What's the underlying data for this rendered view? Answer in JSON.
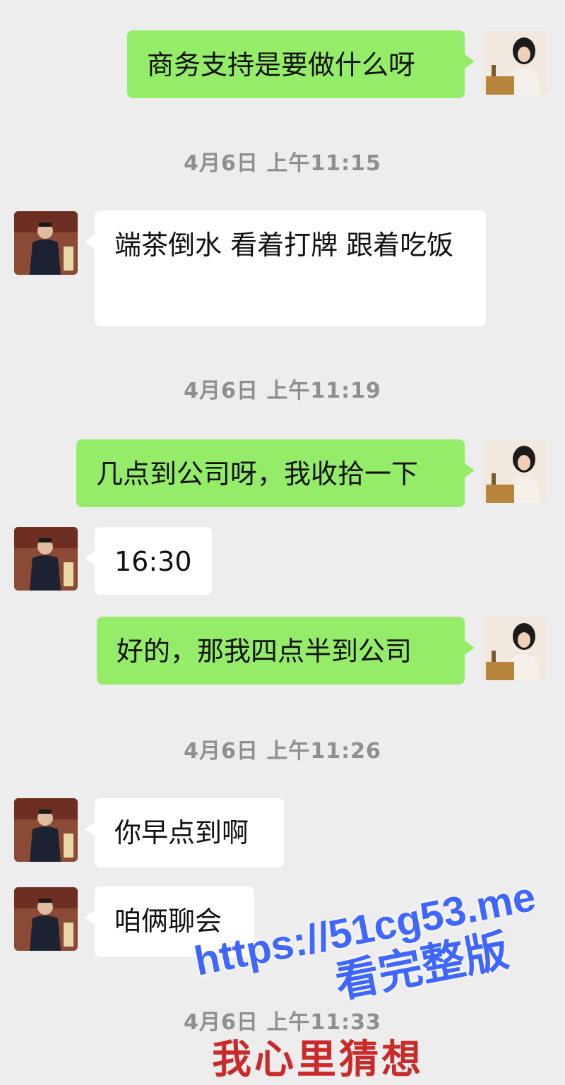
{
  "messages": [
    {
      "side": "me",
      "text": "商务支持是要做什么呀"
    },
    {
      "side": "time",
      "text": "4月6日 上午11:15"
    },
    {
      "side": "other",
      "text": "端茶倒水 看着打牌 跟着吃饭"
    },
    {
      "side": "time",
      "text": "4月6日 上午11:19"
    },
    {
      "side": "me",
      "text": "几点到公司呀，我收拾一下"
    },
    {
      "side": "other",
      "text": "16:30"
    },
    {
      "side": "me",
      "text": "好的，那我四点半到公司"
    },
    {
      "side": "time",
      "text": "4月6日 上午11:26"
    },
    {
      "side": "other",
      "text": "你早点到啊"
    },
    {
      "side": "other",
      "text": "咱俩聊会"
    },
    {
      "side": "time",
      "text": "4月6日 上午11:33"
    }
  ],
  "caption": "我心里猜想",
  "watermark": {
    "url": "https://51cg53.me",
    "subtitle": "看完整版"
  },
  "colors": {
    "background": "#ededed",
    "my_bubble": "#95ec69",
    "other_bubble": "#ffffff",
    "timestamp": "#8f8f8f",
    "caption": "#c92a2a",
    "watermark": "#3f66ff"
  },
  "icons": {
    "my_avatar": "woman-portrait-avatar",
    "other_avatar": "man-in-suit-avatar"
  }
}
